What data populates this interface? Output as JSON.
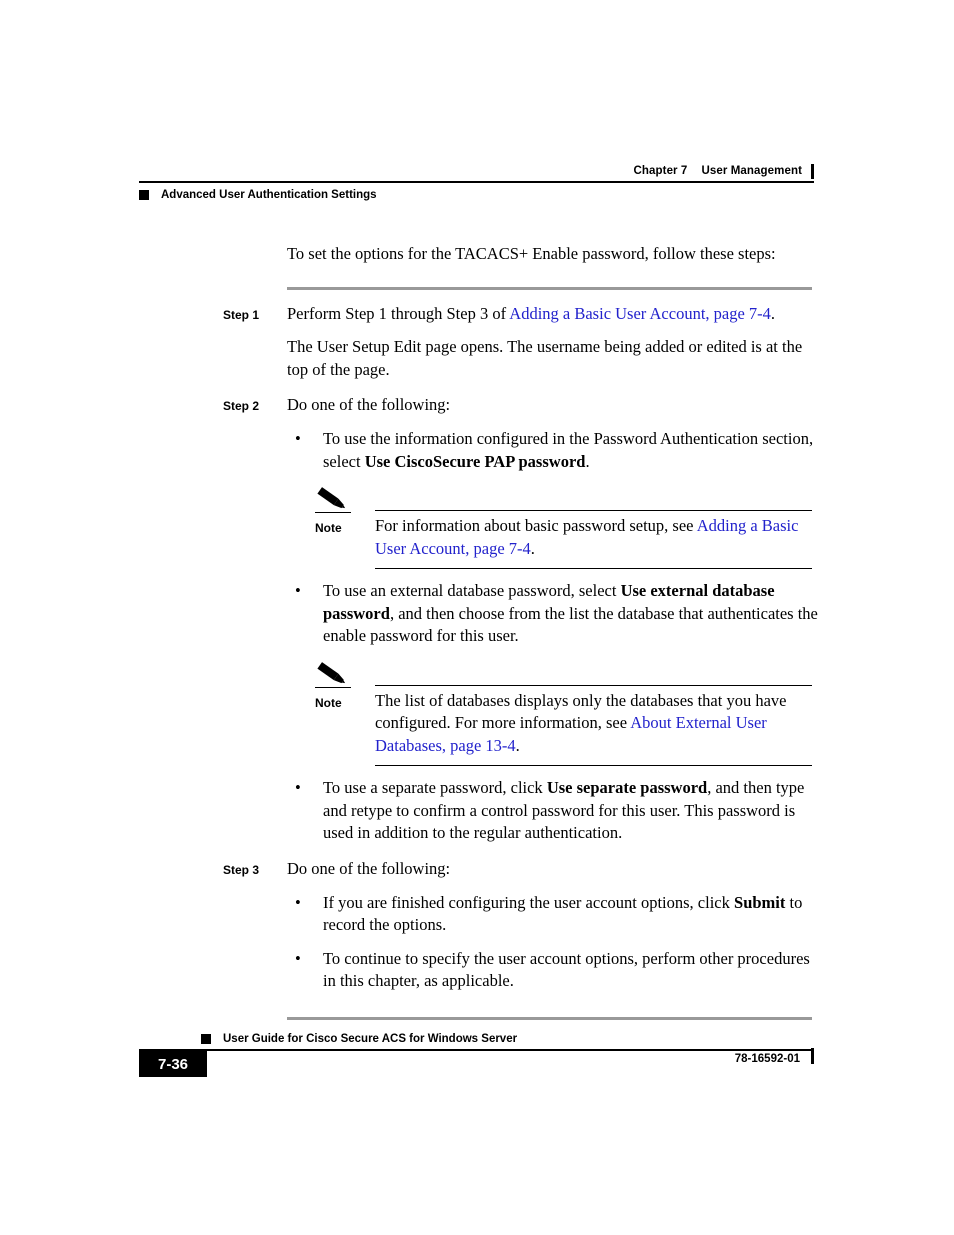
{
  "header": {
    "chapter": "Chapter 7",
    "chapter_title": "User Management",
    "section": "Advanced User Authentication Settings"
  },
  "body": {
    "intro": "To set the options for the TACACS+ Enable password, follow these steps:",
    "steps": [
      {
        "label": "Step 1",
        "text_before": "Perform Step 1 through Step 3 of ",
        "link": "Adding a Basic User Account, page 7-4",
        "text_after": ".",
        "followup": "The User Setup Edit page opens. The username being added or edited is at the top of the page."
      },
      {
        "label": "Step 2",
        "text": "Do one of the following:"
      },
      {
        "label": "Step 3",
        "text": "Do one of the following:"
      }
    ],
    "bullets": {
      "b1_pre": "To use the information configured in the Password Authentication section, select ",
      "b1_bold": "Use CiscoSecure PAP password",
      "b1_post": ".",
      "b2_pre": "To use an external database password, select ",
      "b2_bold": "Use external database password",
      "b2_post": ", and then choose from the list the database that authenticates the enable password for this user.",
      "b3_pre": "To use a separate password, click ",
      "b3_bold": "Use separate password",
      "b3_post": ", and then type and retype to confirm a control password for this user. This password is used in addition to the regular authentication.",
      "b4_pre": "If you are finished configuring the user account options, click ",
      "b4_bold": "Submit",
      "b4_post": " to record the options.",
      "b5_text": "To continue to specify the user account options, perform other procedures in this chapter, as applicable."
    },
    "notes": [
      {
        "label": "Note",
        "text_before": "For information about basic password setup, see ",
        "link": "Adding a Basic User Account, page 7-4",
        "text_after": "."
      },
      {
        "label": "Note",
        "text_before": "The list of databases displays only the databases that you have configured. For more information, see ",
        "link": "About External User Databases, page 13-4",
        "text_after": "."
      }
    ],
    "bullet_glyph": "•"
  },
  "footer": {
    "title": "User Guide for Cisco Secure ACS for Windows Server",
    "page_number": "7-36",
    "doc_number": "78-16592-01"
  },
  "colors": {
    "link": "#2222cc",
    "rule_gray": "#999999",
    "ink": "#000000"
  }
}
